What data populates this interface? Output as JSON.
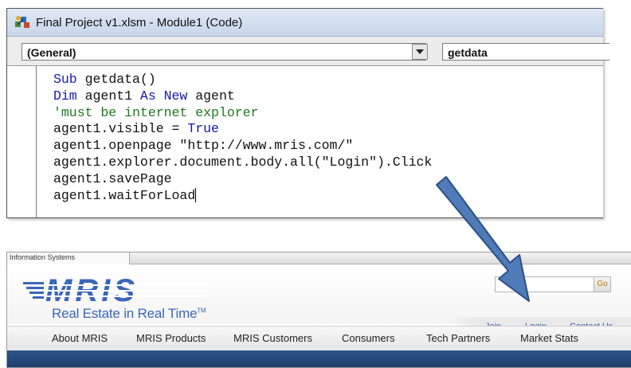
{
  "editor": {
    "title": "Final Project v1.xlsm - Module1 (Code)",
    "object_combo": "(General)",
    "procedure_combo": "getdata",
    "code_lines": [
      [
        {
          "t": "Sub ",
          "k": "kw"
        },
        {
          "t": "getdata()",
          "k": ""
        }
      ],
      [
        {
          "t": "Dim ",
          "k": "kw"
        },
        {
          "t": "agent1 ",
          "k": ""
        },
        {
          "t": "As New ",
          "k": "kw"
        },
        {
          "t": "agent",
          "k": ""
        }
      ],
      [
        {
          "t": "'must be internet explorer",
          "k": "cm"
        }
      ],
      [
        {
          "t": "agent1.visible = ",
          "k": ""
        },
        {
          "t": "True",
          "k": "kw"
        }
      ],
      [
        {
          "t": "agent1.openpage \"http://www.mris.com/\"",
          "k": ""
        }
      ],
      [
        {
          "t": "agent1.explorer.document.body.all(\"Login\").Click",
          "k": ""
        }
      ],
      [
        {
          "t": "agent1.savePage",
          "k": ""
        }
      ],
      [
        {
          "t": "agent1.waitForLoad",
          "k": ""
        }
      ]
    ]
  },
  "browser": {
    "tab_label": "Information Systems",
    "logo_text": "MRIS",
    "tagline": "Real Estate in Real Time",
    "tagline_mark": "TM",
    "go_label": "Go",
    "top_links": {
      "join": "Join",
      "login": "Login",
      "contact": "Contact Us"
    },
    "nav": [
      "About MRIS",
      "MRIS Products",
      "MRIS Customers",
      "Consumers",
      "Tech Partners",
      "Market Stats"
    ]
  },
  "colors": {
    "keyword": "#1a1aa6",
    "comment": "#1f7a1f",
    "brand_blue": "#3b66b8",
    "arrow": "#4f7bb8"
  }
}
